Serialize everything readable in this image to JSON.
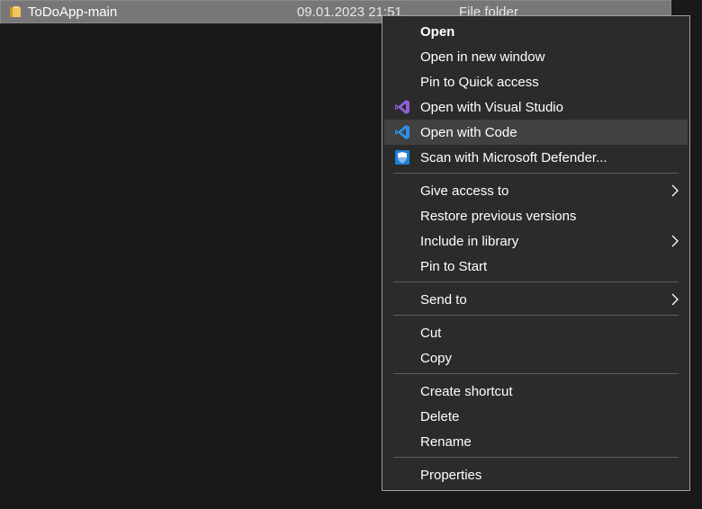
{
  "file_row": {
    "name": "ToDoApp-main",
    "date_modified": "09.01.2023 21:51",
    "type": "File folder"
  },
  "context_menu": {
    "open": "Open",
    "open_new_window": "Open in new window",
    "pin_quick_access": "Pin to Quick access",
    "open_visual_studio": "Open with Visual Studio",
    "open_with_code": "Open with Code",
    "scan_defender": "Scan with Microsoft Defender...",
    "give_access": "Give access to",
    "restore_versions": "Restore previous versions",
    "include_library": "Include in library",
    "pin_start": "Pin to Start",
    "send_to": "Send to",
    "cut": "Cut",
    "copy": "Copy",
    "create_shortcut": "Create shortcut",
    "delete": "Delete",
    "rename": "Rename",
    "properties": "Properties"
  },
  "colors": {
    "background": "#191919",
    "menu_background": "#2b2b2b",
    "menu_hover": "#414141",
    "selected_row": "#777777",
    "visual_studio_purple": "#8e5fd6",
    "vscode_blue": "#2f8fe4",
    "defender_blue": "#1c7fd8",
    "folder_yellow": "#f2c55c"
  },
  "icons": {
    "folder": "folder-icon",
    "visual_studio": "visual-studio-icon",
    "vscode": "vscode-icon",
    "defender": "defender-shield-icon",
    "submenu": "chevron-right-icon"
  }
}
